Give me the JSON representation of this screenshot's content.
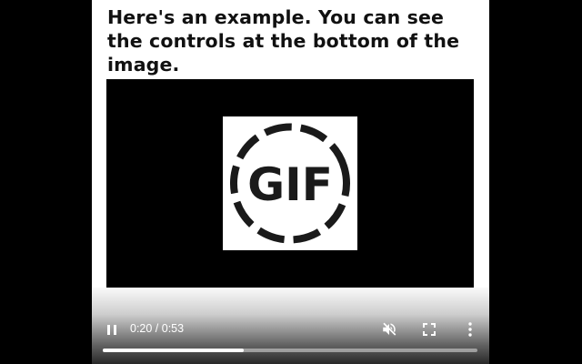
{
  "caption": "Here's an example. You can see the controls at the bottom of the image.",
  "video": {
    "poster_text": "GIF",
    "current_time": "0:20",
    "duration": "0:53",
    "time_display": "0:20 / 0:53",
    "progress": 0.377,
    "state": "playing",
    "muted": true
  },
  "icons": {
    "play_pause": "pause-icon",
    "mute": "volume-muted-icon",
    "fullscreen": "fullscreen-icon",
    "menu": "more-vert-icon"
  },
  "colors": {
    "background": "#000000",
    "page": "#ffffff",
    "controls": "#ffffff"
  }
}
